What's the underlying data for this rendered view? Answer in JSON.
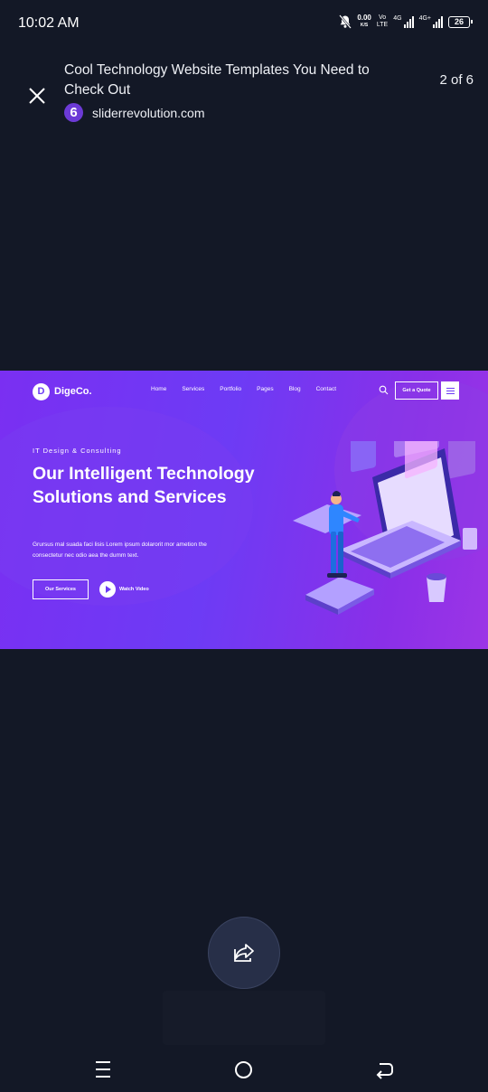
{
  "status_bar": {
    "time": "10:02 AM",
    "net_speed": "0.00",
    "net_unit": "K/S",
    "volte_top": "Vo",
    "volte_bottom": "LTE",
    "sig1_label": "4G",
    "sig2_label": "4G+",
    "battery": "26"
  },
  "viewer": {
    "title": "Cool Technology Website Templates You Need to Check Out",
    "source_logo": "6",
    "source_name": "sliderrevolution.com",
    "counter": "2 of 6"
  },
  "slide": {
    "logo": "DigeCo.",
    "logo_mark": "D",
    "menu": [
      "Home",
      "Services",
      "Portfolio",
      "Pages",
      "Blog",
      "Contact"
    ],
    "quote_button": "Get a Quote",
    "eyebrow": "IT Design & Consulting",
    "heading": "Our Intelligent Technology Solutions and Services",
    "body": "Grursus mal suada faci lisis Lorem ipsum dolarorit mor ametion the consectetur nec odio aea the dumm text.",
    "primary_button": "Our Services",
    "video_label": "Watch Video"
  },
  "icons": {
    "close": "close-icon",
    "share": "share-icon",
    "nav_menu": "recent-apps-icon",
    "nav_home": "home-icon",
    "nav_back": "back-icon"
  },
  "colors": {
    "background": "#131826",
    "slide_purple": "#6d3bf5",
    "fab": "#272f48"
  }
}
